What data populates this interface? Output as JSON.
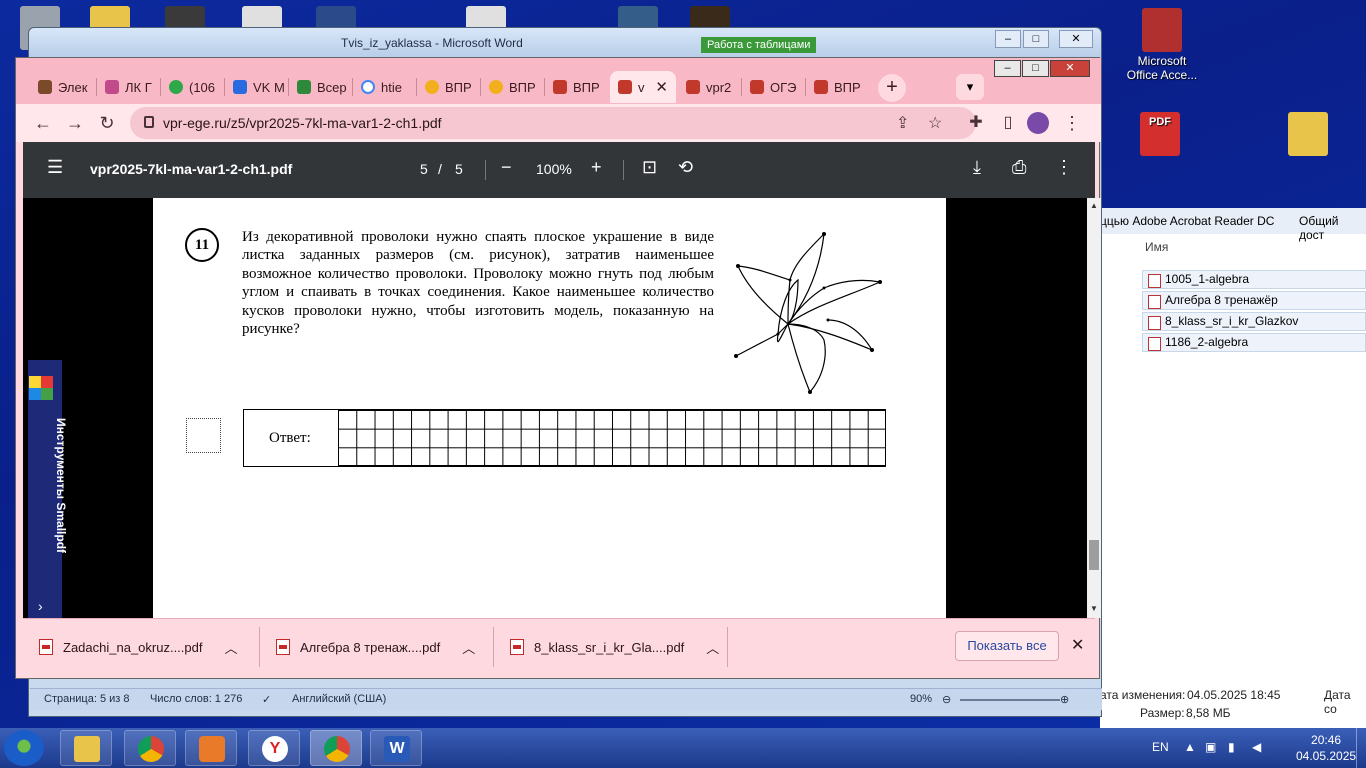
{
  "desktop": {
    "icons": [
      {
        "label": "",
        "color": "#9aa3ad"
      },
      {
        "label": "",
        "color": "#e8c54a"
      },
      {
        "label": "",
        "color": "#3a3a3a"
      },
      {
        "label": "",
        "color": "#e0e0e0"
      },
      {
        "label": "",
        "color": "#2b4a8a"
      },
      {
        "label": "",
        "color": "#e0e0e0"
      },
      {
        "label": "",
        "color": "#355d8a"
      },
      {
        "label": "",
        "color": "#3a2a1a"
      }
    ],
    "access_icon_label": "Microsoft Office Acce...",
    "access_color": "#b03030",
    "pdf_color": "#d32f2f",
    "pdf_label": "PDF",
    "folder_color": "#e8c54a"
  },
  "word": {
    "title": "Tvis_iz_yaklassa - Microsoft Word",
    "context_tab": "Работа с таблицами",
    "status_page": "Страница: 5 из 8",
    "status_words": "Число слов: 1 276",
    "status_lang": "Английский (США)",
    "zoom": "90%"
  },
  "explorer": {
    "toolbar_items": [
      "ццью Adobe Acrobat Reader DC",
      "Общий дост"
    ],
    "column_name": "Имя",
    "files": [
      "1005_1-algebra",
      "Алгебра 8 тренажёр",
      "8_klass_sr_i_kr_Glazkov",
      "1186_2-algebra"
    ],
    "modified_label": "ата изменения:",
    "modified_value": "04.05.2025 18:45",
    "date_col": "Дата со",
    "size_label": "Размер:",
    "size_value": "8,58 МБ"
  },
  "chrome": {
    "tabs": [
      {
        "label": "Элек",
        "color": "#7a4a2a"
      },
      {
        "label": "ЛК Г",
        "color": "#c04a8a"
      },
      {
        "label": "(106",
        "color": "#2ea84a"
      },
      {
        "label": "VK M",
        "color": "#2a6ae0"
      },
      {
        "label": "Всер",
        "color": "#2e8a3a"
      },
      {
        "label": "htie",
        "color": "#ffffff"
      },
      {
        "label": "ВПР",
        "color": "#f2b01e"
      },
      {
        "label": "ВПР",
        "color": "#f2b01e"
      },
      {
        "label": "ВПР",
        "color": "#c0392b"
      },
      {
        "label": "v",
        "color": "#c0392b"
      },
      {
        "label": "vpr2",
        "color": "#c0392b"
      },
      {
        "label": "ОГЭ",
        "color": "#c0392b"
      },
      {
        "label": "ВПР",
        "color": "#c0392b"
      }
    ],
    "url": "vpr-ege.ru/z5/vpr2025-7kl-ma-var1-2-ch1.pdf"
  },
  "pdf": {
    "filename": "vpr2025-7kl-ma-var1-2-ch1.pdf",
    "page_current": "5",
    "page_sep": "/",
    "page_total": "5",
    "zoom": "100%",
    "question_number": "11",
    "question_text": "Из декоративной проволоки нужно спаять плоское украшение в виде листка заданных размеров (см. рисунок), затратив наименьшее возможное количество проволоки. Проволоку можно гнуть под любым углом и спаивать в точках соединения. Какое наименьшее количество кусков проволоки нужно, чтобы изготовить модель, показанную на рисунке?",
    "answer_label": "Ответ:"
  },
  "smallpdf": {
    "label": "Инструменты Smallpdf"
  },
  "downloads": {
    "items": [
      "Zadachi_na_okruz....pdf",
      "Алгебра 8 тренаж....pdf",
      "8_klass_sr_i_kr_Gla....pdf"
    ],
    "show_all": "Показать все"
  },
  "taskbar": {
    "lang": "EN",
    "time": "20:46",
    "date": "04.05.2025"
  }
}
